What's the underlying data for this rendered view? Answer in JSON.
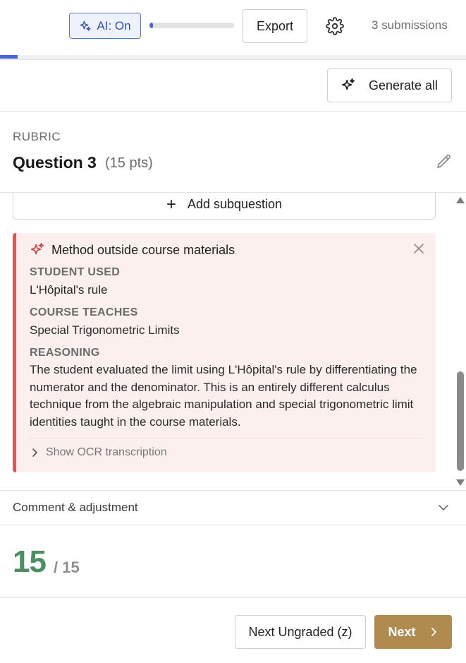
{
  "toolbar": {
    "ai_toggle_label": "AI: On",
    "progress_fraction": 0.04,
    "export_label": "Export",
    "submissions_text": "3 submissions"
  },
  "actions": {
    "generate_all_label": "Generate all"
  },
  "rubric": {
    "section_label": "RUBRIC",
    "question_title": "Question 3",
    "question_points": "(15 pts)",
    "add_subquestion_label": "Add subquestion"
  },
  "flag": {
    "title": "Method outside course materials",
    "student_used_label": "STUDENT USED",
    "student_used_value": "L'Hôpital's rule",
    "course_teaches_label": "COURSE TEACHES",
    "course_teaches_value": "Special Trigonometric Limits",
    "reasoning_label": "REASONING",
    "reasoning_text": "The student evaluated the limit using L'Hôpital's rule by differentiating the numerator and the denominator. This is an entirely different calculus technique from the algebraic manipulation and special trigonometric limit identities taught in the course materials.",
    "ocr_toggle_label": "Show OCR transcription"
  },
  "comment": {
    "label": "Comment & adjustment"
  },
  "score": {
    "value": "15",
    "max": "/ 15"
  },
  "footer": {
    "next_ungraded_label": "Next Ungraded (z)",
    "next_label": "Next"
  },
  "colors": {
    "accent_blue": "#4a63d6",
    "flag_red": "#dd5757",
    "flag_bg": "#fbf0ee",
    "score_green": "#4c8f63",
    "next_gold": "#b08a4f"
  }
}
